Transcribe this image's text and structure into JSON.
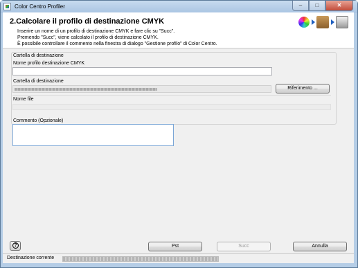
{
  "window": {
    "title": "Color Centro Profiler",
    "controls": {
      "minimize": "–",
      "maximize": "□",
      "close": "✕"
    }
  },
  "header": {
    "title": "2.Calcolare il profilo di destinazione CMYK",
    "lines": [
      "Inserire un nome di un profilo di destinazione CMYK e fare clic su \"Succ\".",
      "Premendo \"Succ\", viene calcolato il profilo di destinazione CMYK.",
      "È possibile controllare il commento nella finestra di dialogo \"Gestione profilo\" di Color Centro."
    ],
    "icons": [
      "color-wheel-icon",
      "box-icon",
      "printer-icon"
    ]
  },
  "destination": {
    "group_label": "Cartella di destinazione",
    "profile_name_label": "Nome profilo destinazione CMYK",
    "profile_name_value": "",
    "folder_label": "Cartella di destinazione",
    "browse_button": "Riferimento ...",
    "file_name_label": "Nome file",
    "file_name_value": ""
  },
  "comment": {
    "label": "Commento (Opzionale)",
    "value": ""
  },
  "footer": {
    "help_label": "?",
    "prev_button": "Pst",
    "next_button": "Succ",
    "cancel_button": "Annulla",
    "next_enabled": false
  },
  "statusbar": {
    "label": "Destinazione corrente"
  },
  "colors": {
    "frame": "#b5cde6",
    "client_bg": "#f0f0f0",
    "arrow": "#1f5fbf"
  }
}
